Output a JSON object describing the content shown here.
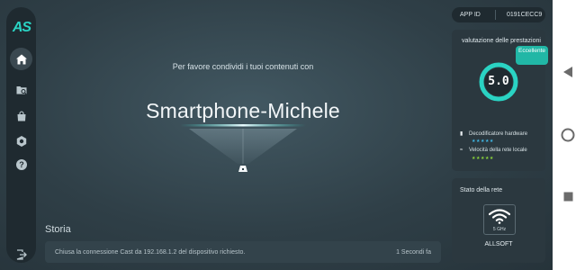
{
  "sidebar": {
    "logo": "AS",
    "items": [
      {
        "icon": "home-icon",
        "active": true
      },
      {
        "icon": "folder-search-icon",
        "active": false
      },
      {
        "icon": "shopping-bag-icon",
        "active": false
      },
      {
        "icon": "settings-icon",
        "active": false
      },
      {
        "icon": "help-icon",
        "active": false
      }
    ],
    "exit_icon": "exit-icon"
  },
  "main": {
    "prompt": "Per favore condividi i tuoi contenuti con",
    "device_name": "Smartphone-Michele",
    "cast_icon": "cast-device-icon"
  },
  "history": {
    "title": "Storia",
    "entries": [
      {
        "message": "Chiusa la connessione Cast da 192.168.1.2 del dispositivo richiesto.",
        "time": "1 Secondi fa"
      }
    ]
  },
  "app_id": {
    "label": "APP ID",
    "value": "0191CECC9"
  },
  "performance": {
    "title": "valutazione delle prestazioni",
    "badge": "Eccellente",
    "score": "5.0",
    "metrics": [
      {
        "label": "Decodificatore hardware",
        "icon": "chip-icon",
        "stars": 5,
        "star_color": "#3fb8e6"
      },
      {
        "label": "Velocità della rete locale",
        "icon": "wifi-small-icon",
        "stars": 5,
        "star_color": "#8bd43a"
      }
    ]
  },
  "network": {
    "title": "Stato della rete",
    "band": "5 GHz",
    "name": "ALLSOFT",
    "icon": "wifi-icon"
  },
  "colors": {
    "accent": "#2ad3c3",
    "badge": "#21b7a6",
    "background": "#2f3f47",
    "panel": "#2b383f"
  }
}
